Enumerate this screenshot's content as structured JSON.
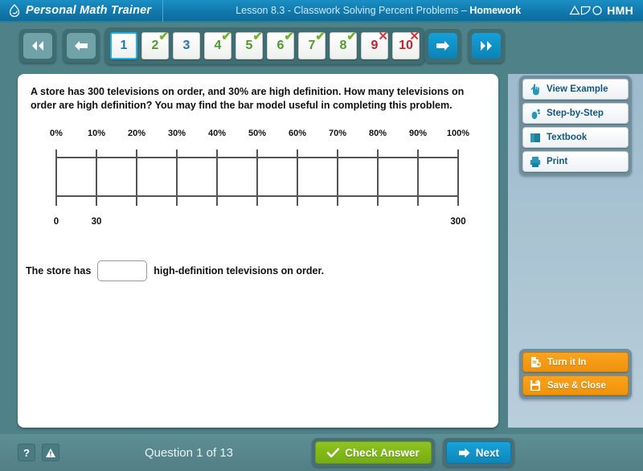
{
  "header": {
    "brand": "Personal Math Trainer",
    "brand_logo_icon": "droplet-outline-icon",
    "lesson_prefix": "Lesson 8.3 - Classwork Solving Percent Problems – ",
    "lesson_mode": "Homework",
    "publisher": "HMH",
    "publisher_mark_icon": "triangle-swoosh-circle-icon"
  },
  "nav": {
    "first_label": "first-question",
    "prev_label": "previous-question",
    "next_label": "next-question",
    "last_label": "last-question",
    "questions": [
      {
        "number": "1",
        "state": "current",
        "mark": ""
      },
      {
        "number": "2",
        "state": "correct",
        "mark": "✔"
      },
      {
        "number": "3",
        "state": "unanswered",
        "mark": ""
      },
      {
        "number": "4",
        "state": "correct",
        "mark": "✔"
      },
      {
        "number": "5",
        "state": "correct",
        "mark": "✔"
      },
      {
        "number": "6",
        "state": "correct",
        "mark": "✔"
      },
      {
        "number": "7",
        "state": "correct",
        "mark": "✔"
      },
      {
        "number": "8",
        "state": "correct",
        "mark": "✔"
      },
      {
        "number": "9",
        "state": "wrong",
        "mark": "✕"
      },
      {
        "number": "10",
        "state": "wrong",
        "mark": "✕"
      }
    ]
  },
  "problem": {
    "text": "A store has 300 televisions on order, and 30% are high definition. How many televisions on order are high definition? You may find the bar model useful in completing this problem.",
    "bar_model": {
      "percent_labels": [
        "0%",
        "10%",
        "20%",
        "30%",
        "40%",
        "50%",
        "60%",
        "70%",
        "80%",
        "90%",
        "100%"
      ],
      "bottom_labels": [
        {
          "text": "0",
          "percent": 0
        },
        {
          "text": "30",
          "percent": 10
        },
        {
          "text": "300",
          "percent": 100
        }
      ]
    },
    "answer_prefix": "The store has",
    "answer_value": "",
    "answer_placeholder": "",
    "answer_suffix": "high-definition televisions on order."
  },
  "sidebar": {
    "tools": [
      {
        "label": "View Example",
        "icon": "pointing-hand-icon"
      },
      {
        "label": "Step-by-Step",
        "icon": "footprint-icon"
      },
      {
        "label": "Textbook",
        "icon": "book-icon"
      },
      {
        "label": "Print",
        "icon": "printer-icon"
      }
    ],
    "actions": [
      {
        "label": "Turn it In",
        "icon": "document-plus-icon"
      },
      {
        "label": "Save & Close",
        "icon": "floppy-disk-icon"
      }
    ]
  },
  "footer": {
    "help_label": "?",
    "alert_icon": "warning-triangle-icon",
    "question_count": "Question 1 of 13",
    "check_answer_label": "Check Answer",
    "check_icon": "checkmark-icon",
    "next_label": "Next",
    "next_icon": "arrow-right-icon"
  },
  "colors": {
    "header_blue": "#1179ac",
    "page_teal": "#4e8288",
    "accent_cyan": "#17a3d9",
    "correct_green": "#6cb42c",
    "wrong_red": "#d9333b",
    "action_orange": "#faa31b",
    "check_green": "#8dc321"
  }
}
